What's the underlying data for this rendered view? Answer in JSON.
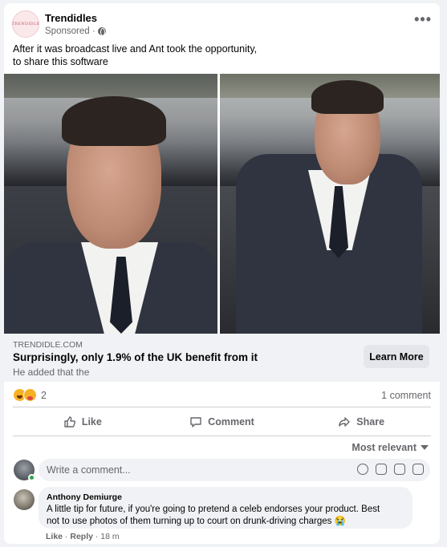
{
  "post": {
    "page_name": "Trendidles",
    "logo_text": "TRENDIDLE",
    "sponsored": "Sponsored ·",
    "text_line1": "After it was broadcast live and Ant took the opportunity,",
    "text_line2": "to share this software"
  },
  "link_preview": {
    "domain": "TRENDIDLE.COM",
    "headline": "Surprisingly, only 1.9% of the UK benefit from it",
    "description": "He added that the",
    "cta": "Learn More"
  },
  "stats": {
    "reaction_count": "2",
    "comment_count": "1 comment"
  },
  "actions": {
    "like": "Like",
    "comment": "Comment",
    "share": "Share"
  },
  "comments_section": {
    "sort_label": "Most relevant",
    "placeholder": "Write a comment...",
    "comment": {
      "author": "Anthony Demiurge",
      "text_line1": "A little tip for future, if you're going to pretend a celeb endorses your product. Best",
      "text_line2": "not to use photos of them turning up to court on drunk-driving charges 😭",
      "like": "Like",
      "sep": " · ",
      "reply": "Reply",
      "time": " · 18 m"
    }
  },
  "icons": [
    "more-icon",
    "globe-icon",
    "haha-reaction-icon",
    "care-reaction-icon",
    "like-icon",
    "comment-icon",
    "share-icon",
    "sort-arrow-icon",
    "emoji-icon",
    "camera-icon",
    "gif-icon",
    "sticker-icon"
  ],
  "colors": {
    "background": "#f0f2f5",
    "secondary_text": "#65676b",
    "online": "#31a24c"
  }
}
